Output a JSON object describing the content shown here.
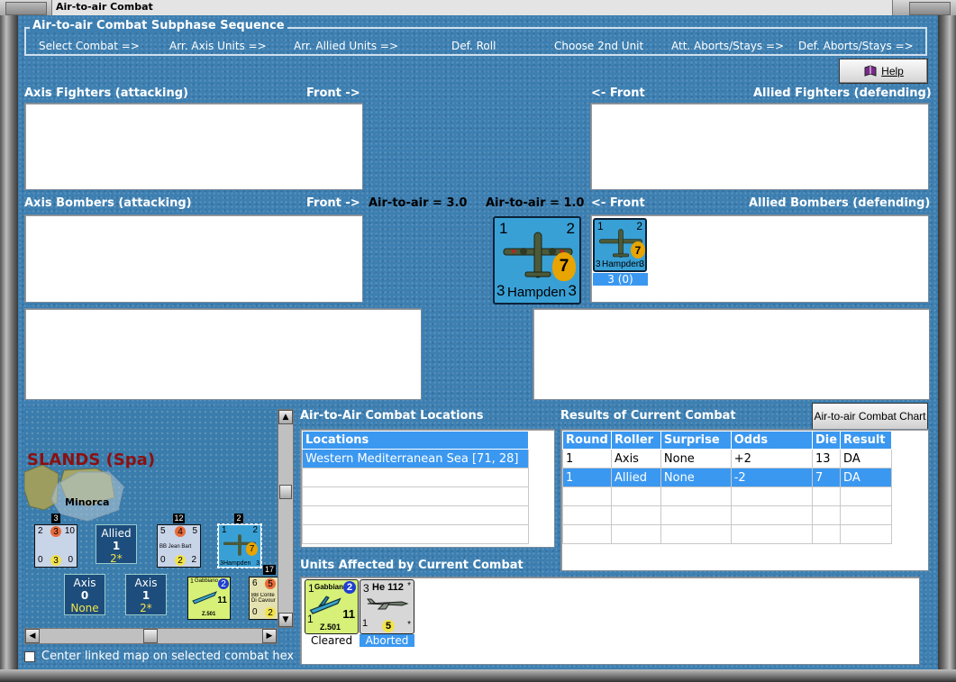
{
  "window": {
    "title": "Air-to-air Combat"
  },
  "subphase": {
    "title": "Air-to-air Combat Subphase Sequence",
    "steps": [
      "Select Combat =>",
      "Arr. Axis Units =>",
      "Arr. Allied Units =>",
      "Def. Roll",
      "Choose 2nd Unit",
      "Att. Aborts/Stays =>",
      "Def. Aborts/Stays =>"
    ]
  },
  "help": {
    "label": "Help"
  },
  "fighters": {
    "axis_label": "Axis Fighters (attacking)",
    "axis_front": "Front ->",
    "allied_front": "<- Front",
    "allied_label": "Allied Fighters (defending)"
  },
  "bombers": {
    "axis_label": "Axis Bombers (attacking)",
    "axis_front": "Front ->",
    "axis_air_to_air": "Air-to-air = 3.0",
    "allied_air_to_air": "Air-to-air = 1.0",
    "allied_front": "<- Front",
    "allied_label": "Allied Bombers (defending)"
  },
  "selected_unit": {
    "top_left": "1",
    "top_right": "2",
    "name": "Hampden",
    "left": "3",
    "right": "3",
    "value": "7"
  },
  "allied_bomber_unit": {
    "top_left": "1",
    "top_right": "2",
    "name": "Hampden",
    "left": "3",
    "right": "3",
    "value": "7",
    "caption": "3 (0)"
  },
  "minimap": {
    "region_label": "SLANDS (Spa)",
    "island_label": "Minorca",
    "allied_box": {
      "title": "Allied",
      "value": "1",
      "sub": "2*"
    },
    "axis_box_1": {
      "title": "Axis",
      "value": "0",
      "sub": "None"
    },
    "axis_box_2": {
      "title": "Axis",
      "value": "1",
      "sub": "2*"
    },
    "stack_counts": [
      "3",
      "12",
      "2",
      "17"
    ],
    "counters": [
      {
        "top": "2",
        "mid": "3",
        "right": "10",
        "bl": "0",
        "bc": "3",
        "br": "0"
      },
      {
        "top": "5",
        "mid": "4",
        "right": "5",
        "name": "BB Jean Bart",
        "bl": "0",
        "bc": "2",
        "br": "2"
      },
      {
        "name": "Hampden",
        "top_left": "1",
        "top_right": "2",
        "left": "3",
        "right": "3",
        "value": "7"
      },
      {
        "name": "Gabbiano",
        "id": "Z.501",
        "top_left": "1",
        "top_right": "2",
        "value": "11"
      },
      {
        "top": "6",
        "mid": "5",
        "name": "BB Conte Di Cavour",
        "bl": "0",
        "bc": "2"
      }
    ]
  },
  "center_map": {
    "label": "Center linked map on selected combat hex",
    "checked": false
  },
  "locations": {
    "title": "Air-to-Air Combat Locations",
    "header": "Locations",
    "rows": [
      "Western Mediterranean Sea [71, 28]",
      "",
      "",
      "",
      "",
      ""
    ]
  },
  "results": {
    "title": "Results of Current Combat",
    "chart_button": "Air-to-air Combat Chart",
    "headers": [
      "Round",
      "Roller",
      "Surprise",
      "Odds",
      "Die",
      "Result"
    ],
    "rows": [
      [
        "1",
        "Axis",
        "None",
        "+2",
        "13",
        "DA"
      ],
      [
        "1",
        "Allied",
        "None",
        "-2",
        "7",
        "DA"
      ],
      [
        "",
        "",
        "",
        "",
        "",
        ""
      ],
      [
        "",
        "",
        "",
        "",
        "",
        ""
      ],
      [
        "",
        "",
        "",
        "",
        "",
        ""
      ]
    ]
  },
  "affected": {
    "title": "Units Affected by Current Combat",
    "units": [
      {
        "name": "Gabbiano",
        "id": "Z.501",
        "top_left": "1",
        "top_right": "2",
        "left": "1",
        "value": "11",
        "caption": "Cleared"
      },
      {
        "name": "He 112",
        "top_left": "3",
        "left": "1",
        "value": "5",
        "corner": "*",
        "caption": "Aborted"
      }
    ]
  }
}
